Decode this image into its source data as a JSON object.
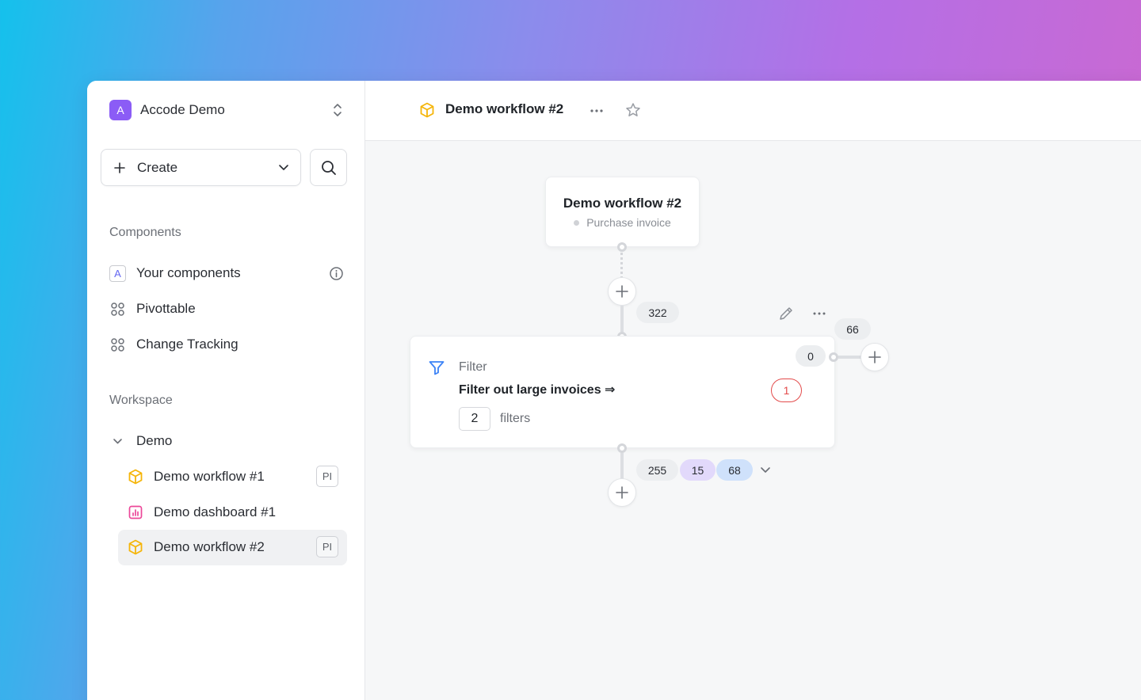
{
  "workspace": {
    "logo_letter": "A",
    "name": "Accode Demo"
  },
  "sidebar": {
    "create_label": "Create",
    "components_title": "Components",
    "components": [
      {
        "label": "Your components",
        "icon": "component-a-icon"
      },
      {
        "label": "Pivottable",
        "icon": "grid-icon"
      },
      {
        "label": "Change Tracking",
        "icon": "grid-icon"
      }
    ],
    "workspace_title": "Workspace",
    "folder": {
      "label": "Demo",
      "expanded": true
    },
    "items": [
      {
        "label": "Demo workflow #1",
        "icon": "workflow-cube-icon",
        "tag": "PI"
      },
      {
        "label": "Demo dashboard #1",
        "icon": "dashboard-chart-icon",
        "tag": ""
      },
      {
        "label": "Demo workflow #2",
        "icon": "workflow-cube-icon",
        "tag": "PI",
        "active": true
      }
    ]
  },
  "header": {
    "title": "Demo workflow #2"
  },
  "canvas": {
    "start_node": {
      "title": "Demo workflow #2",
      "subtitle": "Purchase invoice"
    },
    "incoming_count": "322",
    "filter_node": {
      "type_label": "Filter",
      "title": "Filter out large invoices ⇒",
      "filter_count": "2",
      "filter_unit": "filters",
      "error_count": "1"
    },
    "side_branch": {
      "top_count": "66",
      "count": "0"
    },
    "output_counts": [
      "255",
      "15",
      "68"
    ]
  },
  "colors": {
    "accent_purple": "#8b5cf6",
    "workflow_yellow": "#f5b50a",
    "dashboard_pink": "#ec4899",
    "filter_blue": "#3b82f6",
    "error_red": "#e34b4b"
  }
}
